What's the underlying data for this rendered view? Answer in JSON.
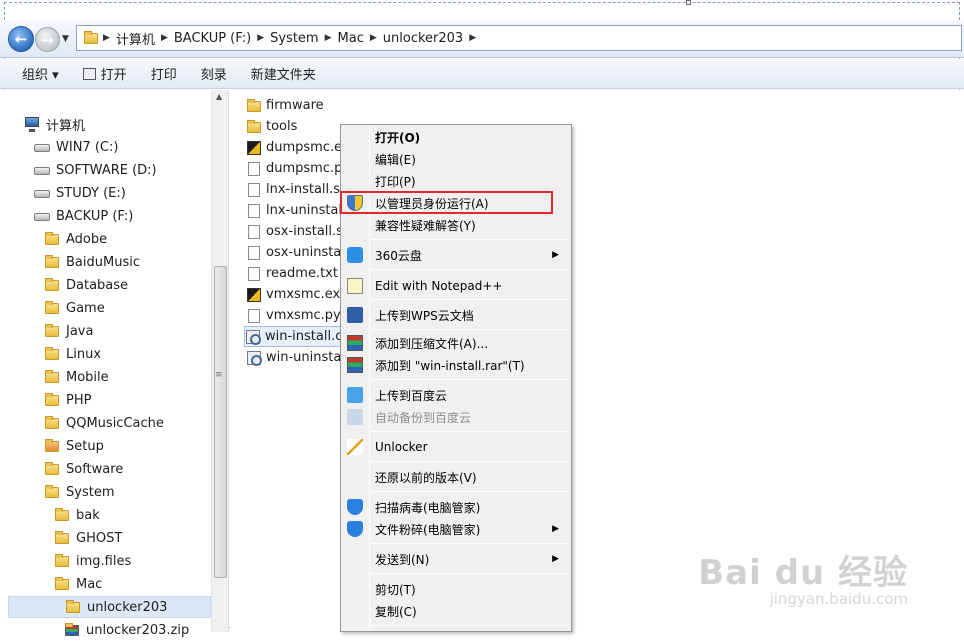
{
  "address": {
    "crumbs": [
      "计算机",
      "BACKUP (F:)",
      "System",
      "Mac",
      "unlocker203"
    ]
  },
  "toolbar": {
    "organize": "组织 ▾",
    "open": "打开",
    "print": "打印",
    "burn": "刻录",
    "new_folder": "新建文件夹"
  },
  "nav": {
    "computer": "计算机",
    "drives": [
      "WIN7 (C:)",
      "SOFTWARE (D:)",
      "STUDY (E:)",
      "BACKUP (F:)"
    ],
    "folders": [
      "Adobe",
      "BaiduMusic",
      "Database",
      "Game",
      "Java",
      "Linux",
      "Mobile",
      "PHP",
      "QQMusicCache",
      "Setup",
      "Software",
      "System"
    ],
    "system_children": [
      "bak",
      "GHOST",
      "img.files",
      "Mac"
    ],
    "mac_child_selected": "unlocker203",
    "mac_child_next": "unlocker203.zip"
  },
  "files": [
    {
      "name": "firmware",
      "type": "folder"
    },
    {
      "name": "tools",
      "type": "folder"
    },
    {
      "name": "dumpsmc.exe",
      "type": "exe"
    },
    {
      "name": "dumpsmc.py",
      "type": "doc"
    },
    {
      "name": "lnx-install.sh",
      "type": "doc"
    },
    {
      "name": "lnx-uninstall.sh",
      "type": "doc"
    },
    {
      "name": "osx-install.sh",
      "type": "doc"
    },
    {
      "name": "osx-uninstall.sh",
      "type": "doc"
    },
    {
      "name": "readme.txt",
      "type": "doc"
    },
    {
      "name": "vmxsmc.exe",
      "type": "exe"
    },
    {
      "name": "vmxsmc.py",
      "type": "doc"
    },
    {
      "name": "win-install.cmd",
      "type": "cmd",
      "selected": true
    },
    {
      "name": "win-uninstall.cmd",
      "type": "cmd"
    }
  ],
  "context_menu": {
    "open": "打开(O)",
    "edit": "编辑(E)",
    "print": "打印(P)",
    "run_as_admin": "以管理员身份运行(A)",
    "compat": "兼容性疑难解答(Y)",
    "cloud360": "360云盘",
    "notepad": "Edit with Notepad++",
    "wps": "上传到WPS云文档",
    "add_archive": "添加到压缩文件(A)...",
    "add_rar": "添加到 \"win-install.rar\"(T)",
    "baidu_upload": "上传到百度云",
    "baidu_backup": "自动备份到百度云",
    "unlocker": "Unlocker",
    "restore": "还原以前的版本(V)",
    "scan": "扫描病毒(电脑管家)",
    "shred": "文件粉碎(电脑管家)",
    "send_to": "发送到(N)",
    "cut": "剪切(T)",
    "copy": "复制(C)"
  },
  "watermark": {
    "brand": "Bai du 经验",
    "url": "jingyan.baidu.com"
  }
}
